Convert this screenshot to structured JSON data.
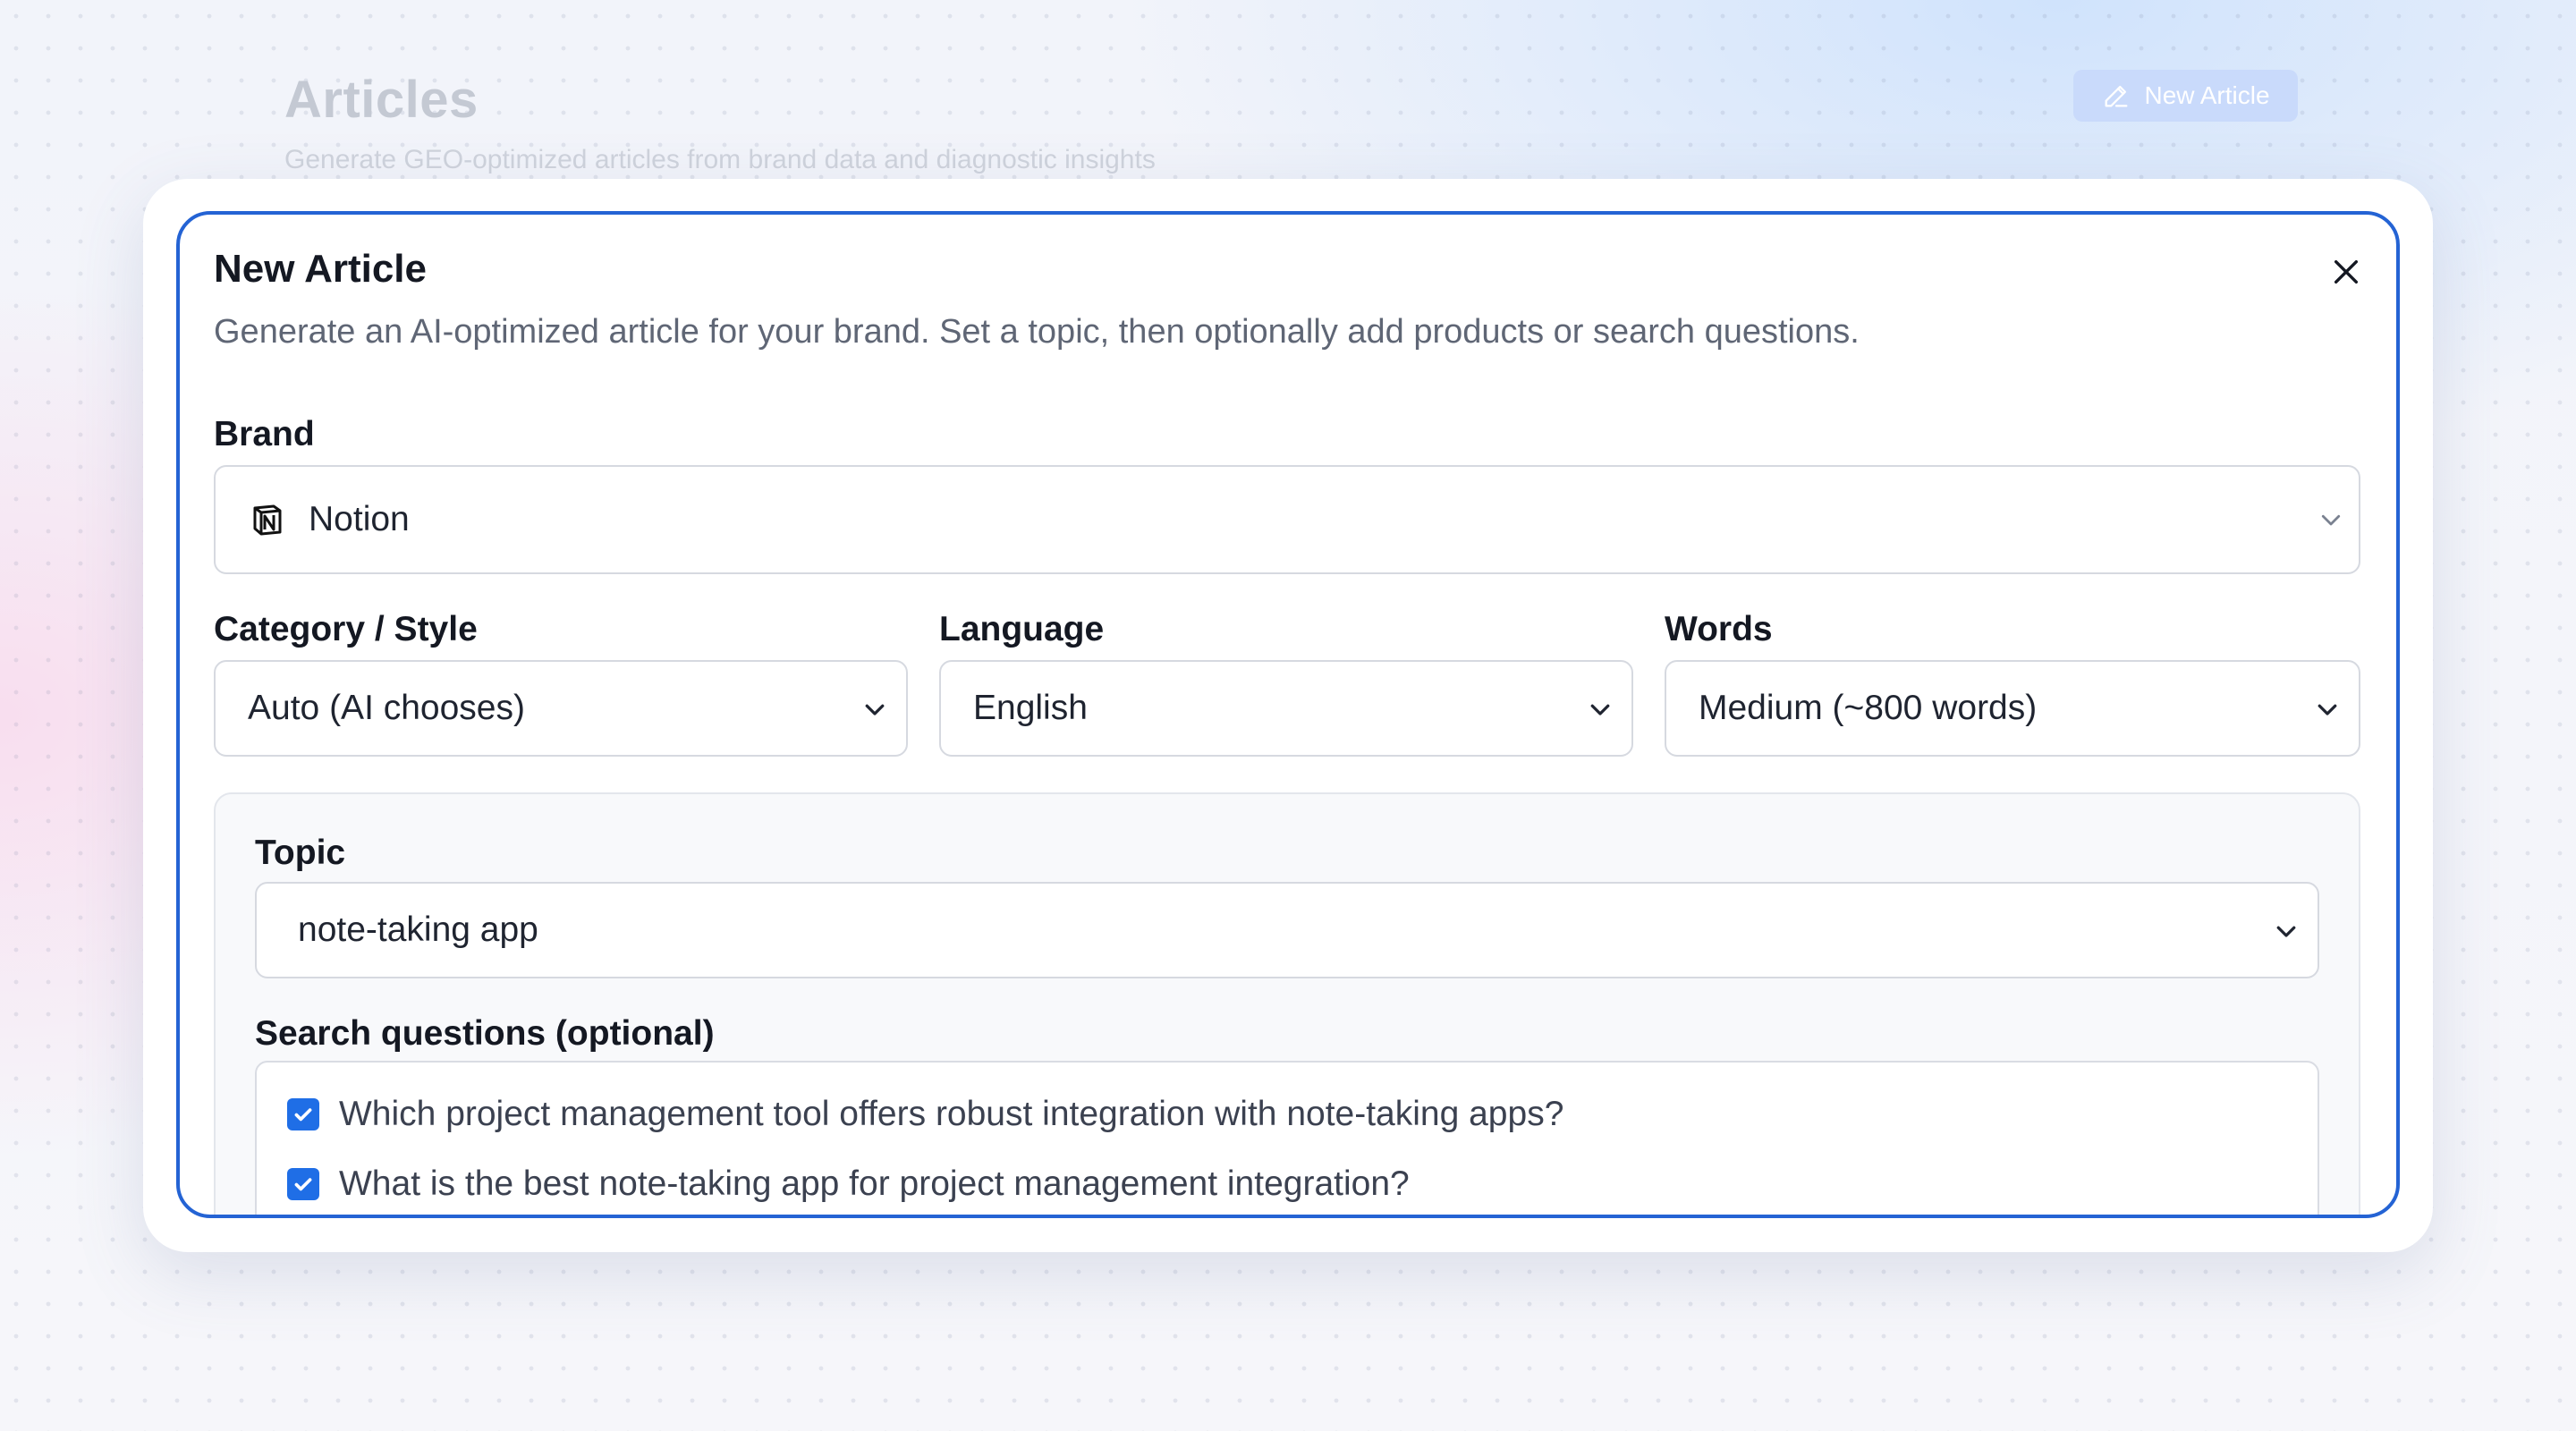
{
  "background": {
    "title": "Articles",
    "subtitle": "Generate GEO-optimized articles from brand data and diagnostic insights",
    "new_article_button": "New Article"
  },
  "modal": {
    "title": "New Article",
    "description": "Generate an AI-optimized article for your brand. Set a topic, then optionally add products or search questions.",
    "brand": {
      "label": "Brand",
      "value": "Notion",
      "icon": "notion-logo"
    },
    "category": {
      "label": "Category / Style",
      "value": "Auto (AI chooses)"
    },
    "language": {
      "label": "Language",
      "value": "English"
    },
    "words": {
      "label": "Words",
      "value": "Medium (~800 words)"
    },
    "topic": {
      "label": "Topic",
      "value": "note-taking app"
    },
    "search_questions": {
      "label": "Search questions (optional)",
      "items": [
        {
          "text": "Which project management tool offers robust integration with note-taking apps?",
          "checked": true
        },
        {
          "text": "What is the best note-taking app for project management integration?",
          "checked": true
        }
      ]
    }
  },
  "colors": {
    "accent": "#2463d4",
    "checkbox": "#1f6ee6"
  }
}
